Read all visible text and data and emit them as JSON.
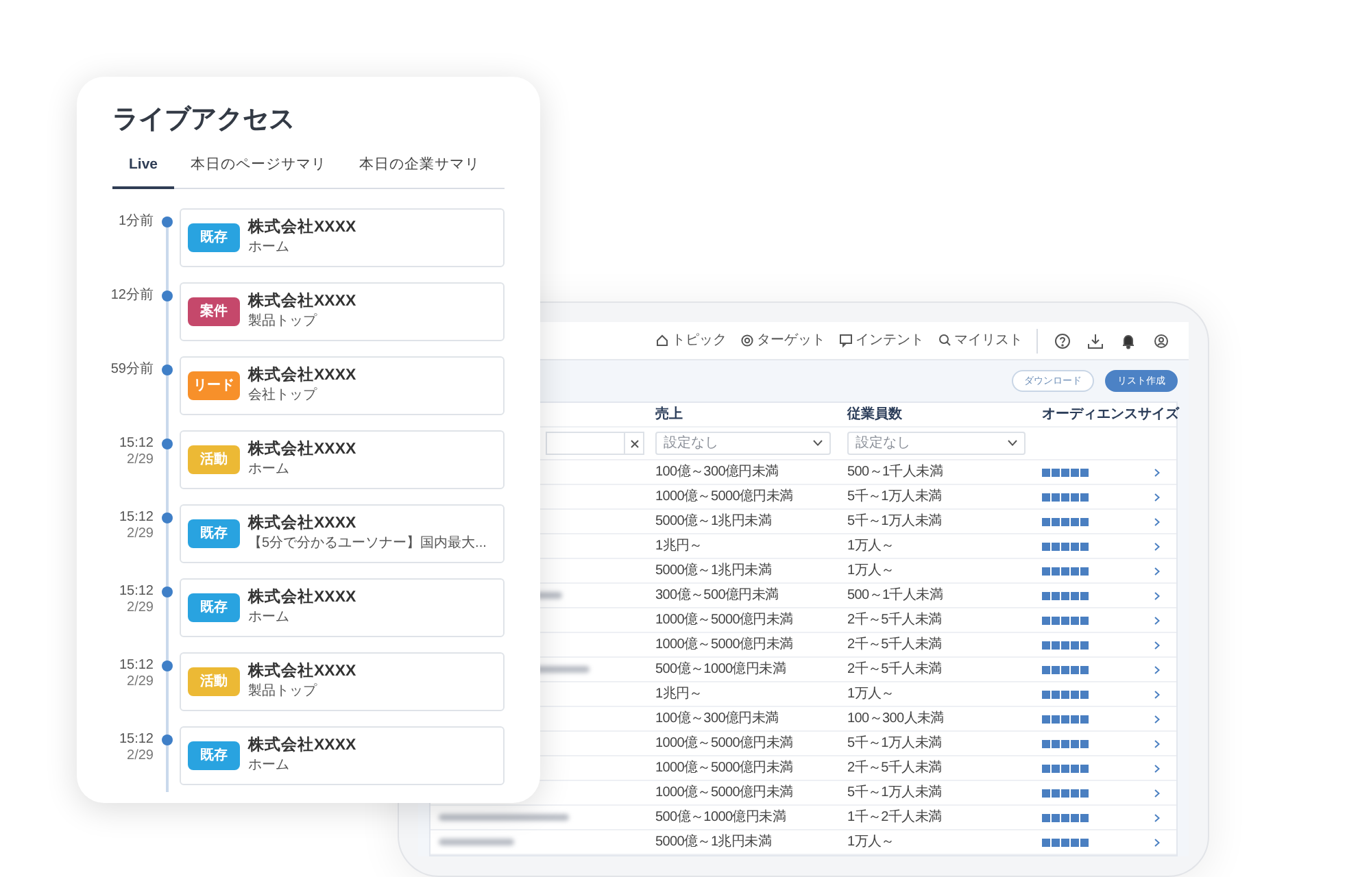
{
  "dashboard": {
    "nav": [
      {
        "label": "トピック"
      },
      {
        "label": "ターゲット"
      },
      {
        "label": "インテント"
      },
      {
        "label": "マイリスト"
      }
    ],
    "actions": [
      {
        "label": "ダウンロード",
        "kind": "outline"
      },
      {
        "label": "リスト作成",
        "kind": "primary"
      }
    ],
    "table": {
      "columns": [
        "売上",
        "従業員数",
        "オーディエンスサイズ"
      ],
      "filters": [
        {
          "placeholder": "設定なし"
        },
        {
          "placeholder": "設定なし"
        }
      ],
      "rows": [
        {
          "revenue": "100億～300億円未満",
          "employees": "500～1千人未満",
          "stars": 5
        },
        {
          "revenue": "1000億～5000億円未満",
          "employees": "5千～1万人未満",
          "stars": 5
        },
        {
          "revenue": "5000億～1兆円未満",
          "employees": "5千～1万人未満",
          "stars": 5
        },
        {
          "revenue": "1兆円～",
          "employees": "1万人～",
          "stars": 5
        },
        {
          "revenue": "5000億～1兆円未満",
          "employees": "1万人～",
          "stars": 5
        },
        {
          "revenue": "300億～500億円未満",
          "employees": "500～1千人未満",
          "stars": 5
        },
        {
          "revenue": "1000億～5000億円未満",
          "employees": "2千～5千人未満",
          "stars": 5
        },
        {
          "revenue": "1000億～5000億円未満",
          "employees": "2千～5千人未満",
          "stars": 5
        },
        {
          "revenue": "500億～1000億円未満",
          "employees": "2千～5千人未満",
          "stars": 5
        },
        {
          "revenue": "1兆円～",
          "employees": "1万人～",
          "stars": 5
        },
        {
          "revenue": "100億～300億円未満",
          "employees": "100～300人未満",
          "stars": 5
        },
        {
          "revenue": "1000億～5000億円未満",
          "employees": "5千～1万人未満",
          "stars": 5
        },
        {
          "revenue": "1000億～5000億円未満",
          "employees": "2千～5千人未満",
          "stars": 5
        },
        {
          "revenue": "1000億～5000億円未満",
          "employees": "5千～1万人未満",
          "stars": 5
        },
        {
          "revenue": "500億～1000億円未満",
          "employees": "1千～2千人未満",
          "stars": 5
        },
        {
          "revenue": "5000億～1兆円未満",
          "employees": "1万人～",
          "stars": 5
        }
      ]
    }
  },
  "live_access": {
    "title": "ライブアクセス",
    "tabs": [
      {
        "label": "Live",
        "selected": true
      },
      {
        "label": "本日のページサマリ",
        "selected": false
      },
      {
        "label": "本日の企業サマリ",
        "selected": false
      }
    ],
    "timeline": [
      {
        "time": "1分前",
        "tag": "既存",
        "color": "#29a3e0",
        "company": "株式会社XXXX",
        "page": "ホーム"
      },
      {
        "time": "12分前",
        "tag": "案件",
        "color": "#c5486b",
        "company": "株式会社XXXX",
        "page": "製品トップ"
      },
      {
        "time": "59分前",
        "tag": "リード",
        "color": "#f7902a",
        "company": "株式会社XXXX",
        "page": "会社トップ"
      },
      {
        "time": "15:12",
        "date": "2/29",
        "tag": "活動",
        "color": "#ecb935",
        "company": "株式会社XXXX",
        "page": "ホーム"
      },
      {
        "time": "15:12",
        "date": "2/29",
        "tag": "既存",
        "color": "#29a3e0",
        "company": "株式会社XXXX",
        "page": "【5分で分かるユーソナー】国内最大..."
      },
      {
        "time": "15:12",
        "date": "2/29",
        "tag": "既存",
        "color": "#29a3e0",
        "company": "株式会社XXXX",
        "page": "ホーム"
      },
      {
        "time": "15:12",
        "date": "2/29",
        "tag": "活動",
        "color": "#ecb935",
        "company": "株式会社XXXX",
        "page": "製品トップ"
      },
      {
        "time": "15:12",
        "date": "2/29",
        "tag": "既存",
        "color": "#29a3e0",
        "company": "株式会社XXXX",
        "page": "ホーム"
      }
    ]
  }
}
